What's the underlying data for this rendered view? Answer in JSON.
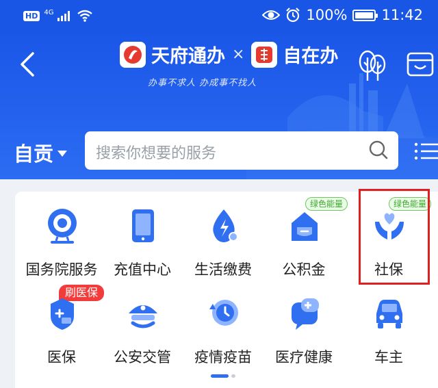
{
  "status_bar": {
    "hd_label": "HD",
    "network_label": "4G",
    "battery_text": "100%",
    "battery_level": 1.0,
    "time": "11:42"
  },
  "header": {
    "logo_left_text": "天府通办",
    "separator": "×",
    "logo_right_text": "自在办",
    "slogan": "办事不求人 办成事不找人"
  },
  "city": {
    "name": "自贡"
  },
  "search": {
    "placeholder": "搜索你想要的服务"
  },
  "services": [
    {
      "label": "国务院服务",
      "icon": "state-council-icon"
    },
    {
      "label": "充值中心",
      "icon": "tablet-icon"
    },
    {
      "label": "生活缴费",
      "icon": "water-drop-icon"
    },
    {
      "label": "公积金",
      "icon": "housing-fund-icon",
      "tag": "绿色能量"
    },
    {
      "label": "社保",
      "icon": "hands-heart-icon",
      "tag": "绿色能量"
    },
    {
      "label": "医保",
      "icon": "medical-shield-icon",
      "tag": "刷医保"
    },
    {
      "label": "公安交管",
      "icon": "police-hat-icon"
    },
    {
      "label": "疫情疫苗",
      "icon": "clock-history-icon"
    },
    {
      "label": "医疗健康",
      "icon": "medical-chat-icon"
    },
    {
      "label": "车主",
      "icon": "car-icon"
    }
  ],
  "colors": {
    "brand_blue": "#1a56e6",
    "icon_blue": "#2f6ff0",
    "tag_green": "#3daa2d",
    "tag_red": "#f23b3b",
    "highlight_red": "#e02020"
  }
}
